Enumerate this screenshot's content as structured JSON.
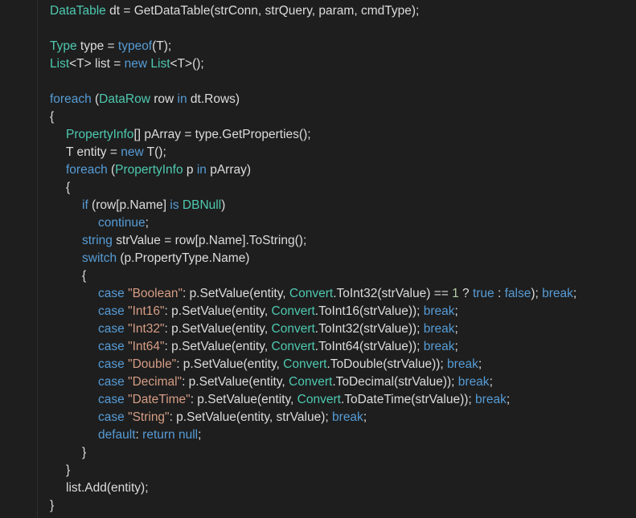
{
  "editor": {
    "theme": "dark",
    "colors": {
      "background": "#1e1e1e",
      "text": "#dcdcdc",
      "type": "#4ec9b0",
      "keyword": "#569cd6",
      "string": "#d69d85",
      "number": "#b5cea8"
    },
    "lines": [
      [
        {
          "c": "t",
          "v": "DataTable"
        },
        {
          "c": "p",
          "v": " dt = GetDataTable(strConn, strQuery, param, cmdType);"
        }
      ],
      [],
      [
        {
          "c": "t",
          "v": "Type"
        },
        {
          "c": "p",
          "v": " type = "
        },
        {
          "c": "k",
          "v": "typeof"
        },
        {
          "c": "p",
          "v": "(T);"
        }
      ],
      [
        {
          "c": "t",
          "v": "List"
        },
        {
          "c": "p",
          "v": "<T> list = "
        },
        {
          "c": "k",
          "v": "new"
        },
        {
          "c": "p",
          "v": " "
        },
        {
          "c": "t",
          "v": "List"
        },
        {
          "c": "p",
          "v": "<T>();"
        }
      ],
      [],
      [
        {
          "c": "k",
          "v": "foreach"
        },
        {
          "c": "p",
          "v": " ("
        },
        {
          "c": "t",
          "v": "DataRow"
        },
        {
          "c": "p",
          "v": " row "
        },
        {
          "c": "k",
          "v": "in"
        },
        {
          "c": "p",
          "v": " dt.Rows)"
        }
      ],
      [
        {
          "c": "p",
          "v": "{"
        }
      ],
      [
        {
          "c": "t",
          "v": "PropertyInfo"
        },
        {
          "c": "p",
          "v": "[] pArray = type.GetProperties();"
        }
      ],
      [
        {
          "c": "p",
          "v": "T entity = "
        },
        {
          "c": "k",
          "v": "new"
        },
        {
          "c": "p",
          "v": " T();"
        }
      ],
      [
        {
          "c": "k",
          "v": "foreach"
        },
        {
          "c": "p",
          "v": " ("
        },
        {
          "c": "t",
          "v": "PropertyInfo"
        },
        {
          "c": "p",
          "v": " p "
        },
        {
          "c": "k",
          "v": "in"
        },
        {
          "c": "p",
          "v": " pArray)"
        }
      ],
      [
        {
          "c": "p",
          "v": "{"
        }
      ],
      [
        {
          "c": "k",
          "v": "if"
        },
        {
          "c": "p",
          "v": " (row[p.Name] "
        },
        {
          "c": "k",
          "v": "is"
        },
        {
          "c": "p",
          "v": " "
        },
        {
          "c": "t",
          "v": "DBNull"
        },
        {
          "c": "p",
          "v": ")"
        }
      ],
      [
        {
          "c": "k",
          "v": "continue"
        },
        {
          "c": "p",
          "v": ";"
        }
      ],
      [
        {
          "c": "k",
          "v": "string"
        },
        {
          "c": "p",
          "v": " strValue = row[p.Name].ToString();"
        }
      ],
      [
        {
          "c": "k",
          "v": "switch"
        },
        {
          "c": "p",
          "v": " (p.PropertyType.Name)"
        }
      ],
      [
        {
          "c": "p",
          "v": "{"
        }
      ],
      [
        {
          "c": "k",
          "v": "case"
        },
        {
          "c": "p",
          "v": " "
        },
        {
          "c": "s",
          "v": "\"Boolean\""
        },
        {
          "c": "p",
          "v": ": p.SetValue(entity, "
        },
        {
          "c": "t",
          "v": "Convert"
        },
        {
          "c": "p",
          "v": ".ToInt32(strValue) == "
        },
        {
          "c": "n",
          "v": "1"
        },
        {
          "c": "p",
          "v": " ? "
        },
        {
          "c": "k",
          "v": "true"
        },
        {
          "c": "p",
          "v": " : "
        },
        {
          "c": "k",
          "v": "false"
        },
        {
          "c": "p",
          "v": "); "
        },
        {
          "c": "k",
          "v": "break"
        },
        {
          "c": "p",
          "v": ";"
        }
      ],
      [
        {
          "c": "k",
          "v": "case"
        },
        {
          "c": "p",
          "v": " "
        },
        {
          "c": "s",
          "v": "\"Int16\""
        },
        {
          "c": "p",
          "v": ": p.SetValue(entity, "
        },
        {
          "c": "t",
          "v": "Convert"
        },
        {
          "c": "p",
          "v": ".ToInt16(strValue)); "
        },
        {
          "c": "k",
          "v": "break"
        },
        {
          "c": "p",
          "v": ";"
        }
      ],
      [
        {
          "c": "k",
          "v": "case"
        },
        {
          "c": "p",
          "v": " "
        },
        {
          "c": "s",
          "v": "\"Int32\""
        },
        {
          "c": "p",
          "v": ": p.SetValue(entity, "
        },
        {
          "c": "t",
          "v": "Convert"
        },
        {
          "c": "p",
          "v": ".ToInt32(strValue)); "
        },
        {
          "c": "k",
          "v": "break"
        },
        {
          "c": "p",
          "v": ";"
        }
      ],
      [
        {
          "c": "k",
          "v": "case"
        },
        {
          "c": "p",
          "v": " "
        },
        {
          "c": "s",
          "v": "\"Int64\""
        },
        {
          "c": "p",
          "v": ": p.SetValue(entity, "
        },
        {
          "c": "t",
          "v": "Convert"
        },
        {
          "c": "p",
          "v": ".ToInt64(strValue)); "
        },
        {
          "c": "k",
          "v": "break"
        },
        {
          "c": "p",
          "v": ";"
        }
      ],
      [
        {
          "c": "k",
          "v": "case"
        },
        {
          "c": "p",
          "v": " "
        },
        {
          "c": "s",
          "v": "\"Double\""
        },
        {
          "c": "p",
          "v": ": p.SetValue(entity, "
        },
        {
          "c": "t",
          "v": "Convert"
        },
        {
          "c": "p",
          "v": ".ToDouble(strValue)); "
        },
        {
          "c": "k",
          "v": "break"
        },
        {
          "c": "p",
          "v": ";"
        }
      ],
      [
        {
          "c": "k",
          "v": "case"
        },
        {
          "c": "p",
          "v": " "
        },
        {
          "c": "s",
          "v": "\"Decimal\""
        },
        {
          "c": "p",
          "v": ": p.SetValue(entity, "
        },
        {
          "c": "t",
          "v": "Convert"
        },
        {
          "c": "p",
          "v": ".ToDecimal(strValue)); "
        },
        {
          "c": "k",
          "v": "break"
        },
        {
          "c": "p",
          "v": ";"
        }
      ],
      [
        {
          "c": "k",
          "v": "case"
        },
        {
          "c": "p",
          "v": " "
        },
        {
          "c": "s",
          "v": "\"DateTime\""
        },
        {
          "c": "p",
          "v": ": p.SetValue(entity, "
        },
        {
          "c": "t",
          "v": "Convert"
        },
        {
          "c": "p",
          "v": ".ToDateTime(strValue)); "
        },
        {
          "c": "k",
          "v": "break"
        },
        {
          "c": "p",
          "v": ";"
        }
      ],
      [
        {
          "c": "k",
          "v": "case"
        },
        {
          "c": "p",
          "v": " "
        },
        {
          "c": "s",
          "v": "\"String\""
        },
        {
          "c": "p",
          "v": ": p.SetValue(entity, strValue); "
        },
        {
          "c": "k",
          "v": "break"
        },
        {
          "c": "p",
          "v": ";"
        }
      ],
      [
        {
          "c": "k",
          "v": "default"
        },
        {
          "c": "p",
          "v": ": "
        },
        {
          "c": "k",
          "v": "return"
        },
        {
          "c": "p",
          "v": " "
        },
        {
          "c": "k",
          "v": "null"
        },
        {
          "c": "p",
          "v": ";"
        }
      ],
      [
        {
          "c": "p",
          "v": "}"
        }
      ],
      [
        {
          "c": "p",
          "v": "}"
        }
      ],
      [
        {
          "c": "p",
          "v": "list.Add(entity);"
        }
      ],
      [
        {
          "c": "p",
          "v": "}"
        }
      ]
    ]
  }
}
